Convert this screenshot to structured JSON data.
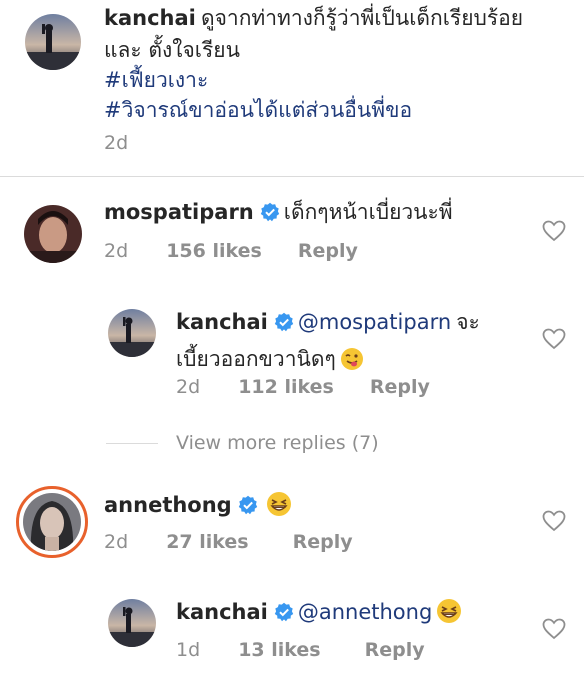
{
  "comments": [
    {
      "username": "kanchai",
      "text_line1": "ดูจากท่าทางก็รู้ว่าพี่เป็นเด็กเรียบร้อย",
      "text_line2": "และ ตั้งใจเรียน",
      "hashtag1": "#เฟี้ยวเงาะ",
      "hashtag2": "#วิจารณ์ขาอ่อนได้แต่ส่วนอื่นพี่ขอ",
      "time": "2d"
    },
    {
      "username": "mospatiparn",
      "text": "เด็กๆหน้าเบี่ยวนะพี่",
      "time": "2d",
      "likes": "156 likes",
      "reply_label": "Reply"
    },
    {
      "username": "kanchai",
      "mention": "@mospatiparn",
      "text_after_mention": "จะ",
      "text_line2": "เบี้ยวออกขวานิดๆ",
      "time": "2d",
      "likes": "112 likes",
      "reply_label": "Reply"
    },
    {
      "username": "annethong",
      "time": "2d",
      "likes": "27 likes",
      "reply_label": "Reply"
    },
    {
      "username": "kanchai",
      "mention": "@annethong",
      "time": "1d",
      "likes": "13 likes",
      "reply_label": "Reply"
    }
  ],
  "view_more_replies": "View more replies (7)",
  "icons": {
    "verified": "verified-badge-icon",
    "heart": "heart-outline-icon",
    "emoji_grin": "grinning-squint-emoji-icon",
    "emoji_wink": "winking-tongue-emoji-icon"
  },
  "colors": {
    "verified_blue": "#3897f0",
    "hashtag_blue": "#1f3a7a",
    "meta_gray": "#8e8e8e",
    "story_ring_orange": "#e8612c"
  }
}
